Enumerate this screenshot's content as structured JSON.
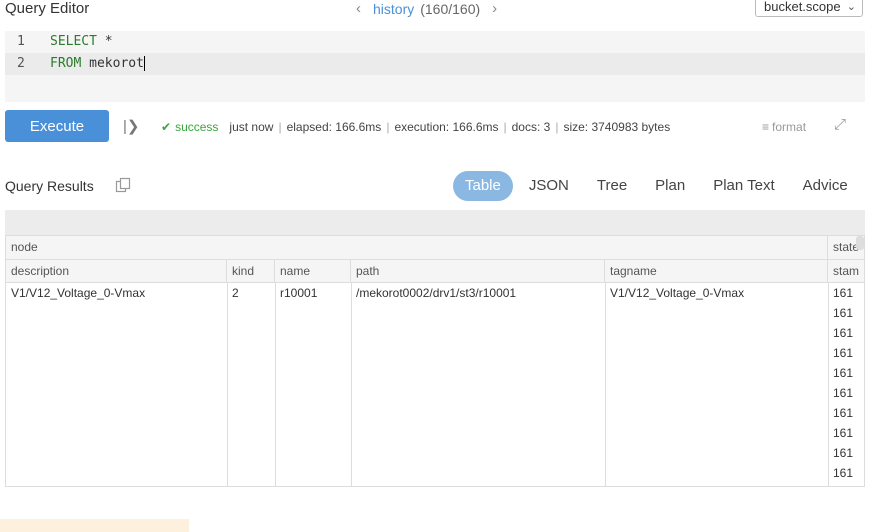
{
  "header": {
    "title": "Query Editor",
    "history_label": "history",
    "history_count": "(160/160)",
    "scope": "bucket.scope"
  },
  "editor": {
    "line1_num": "1",
    "line1_kw": "SELECT",
    "line1_rest": " *",
    "line2_num": "2",
    "line2_kw": "FROM",
    "line2_rest": " mekorot"
  },
  "toolbar": {
    "execute_label": "Execute",
    "status": "success",
    "time": "just now",
    "elapsed": "elapsed: 166.6ms",
    "execution": "execution: 166.6ms",
    "docs": "docs: 3",
    "size": "size: 3740983 bytes",
    "format_label": "format"
  },
  "results": {
    "title": "Query Results",
    "tabs": [
      "Table",
      "JSON",
      "Tree",
      "Plan",
      "Plan Text",
      "Advice"
    ],
    "group_header": "node",
    "group_header2": "state",
    "columns": [
      "description",
      "kind",
      "name",
      "path",
      "tagname",
      "stam"
    ],
    "rows": [
      [
        "V1/V12_Voltage_0-Vmax",
        "2",
        "r10001",
        "/mekorot0002/drv1/st3/r10001",
        "V1/V12_Voltage_0-Vmax",
        "161"
      ],
      [
        "",
        "",
        "",
        "",
        "",
        "161"
      ],
      [
        "",
        "",
        "",
        "",
        "",
        "161"
      ],
      [
        "",
        "",
        "",
        "",
        "",
        "161"
      ],
      [
        "",
        "",
        "",
        "",
        "",
        "161"
      ],
      [
        "",
        "",
        "",
        "",
        "",
        "161"
      ],
      [
        "",
        "",
        "",
        "",
        "",
        "161"
      ],
      [
        "",
        "",
        "",
        "",
        "",
        "161"
      ],
      [
        "",
        "",
        "",
        "",
        "",
        "161"
      ],
      [
        "",
        "",
        "",
        "",
        "",
        "161"
      ]
    ]
  },
  "colors": {
    "accent": "#4a90d9",
    "tab_active": "#8ab8e3",
    "success": "#3aa53a"
  }
}
